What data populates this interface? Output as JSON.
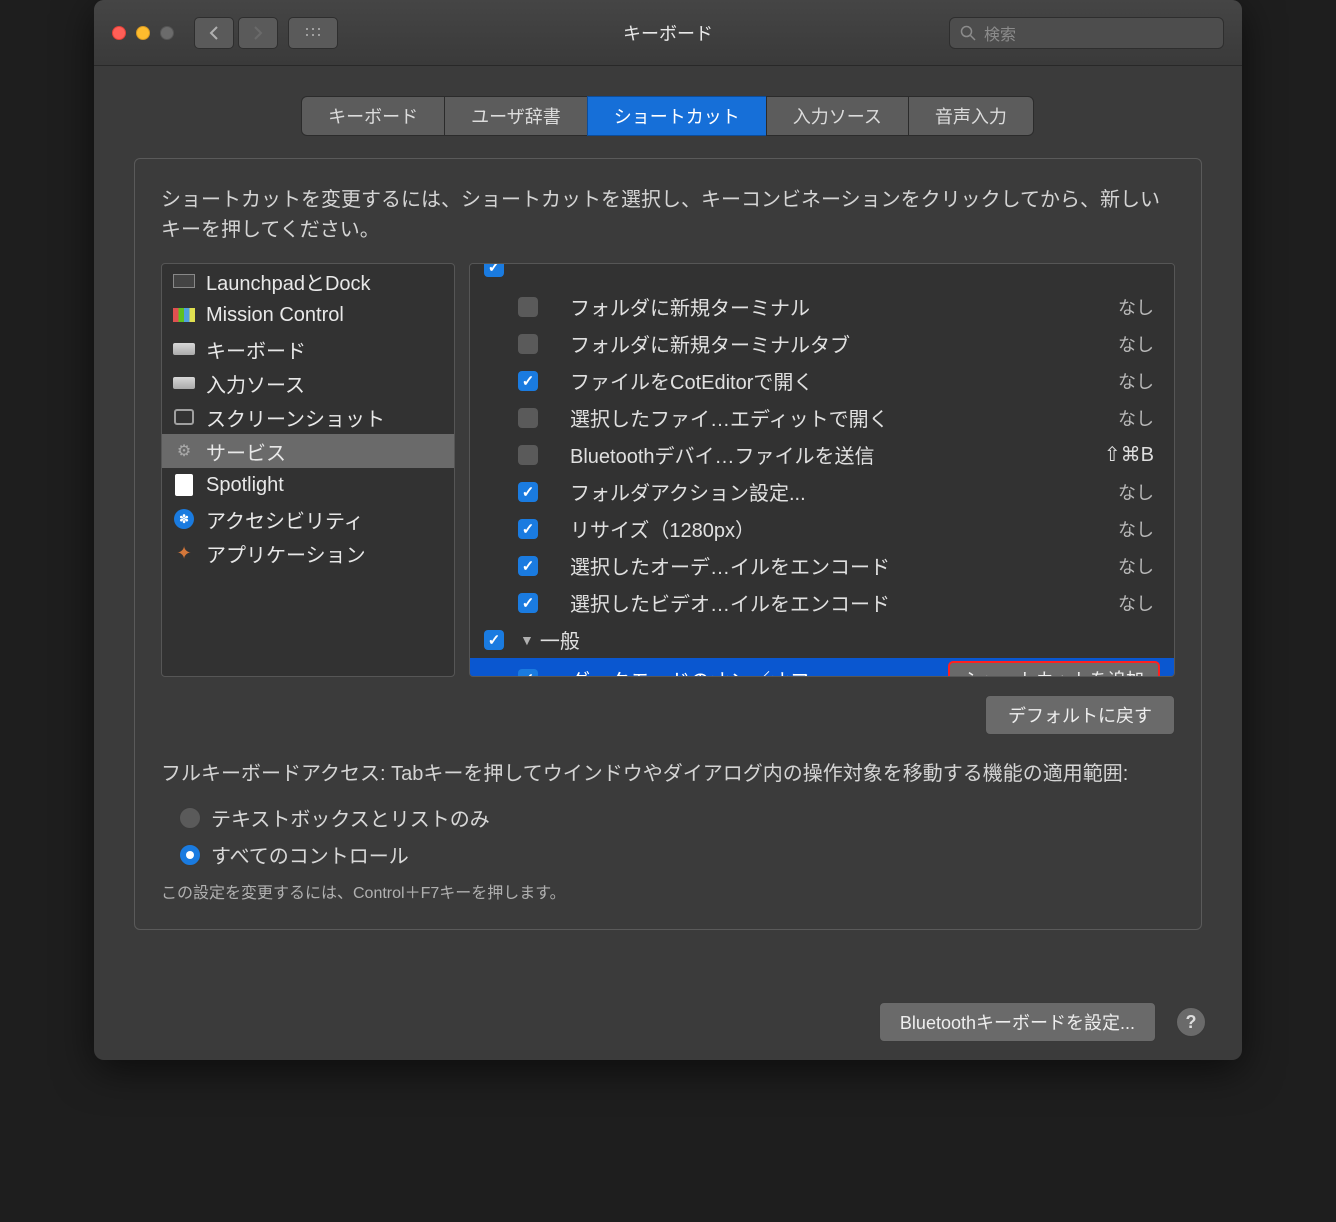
{
  "window": {
    "title": "キーボード",
    "search_placeholder": "検索"
  },
  "tabs": [
    {
      "label": "キーボード",
      "active": false
    },
    {
      "label": "ユーザ辞書",
      "active": false
    },
    {
      "label": "ショートカット",
      "active": true
    },
    {
      "label": "入力ソース",
      "active": false
    },
    {
      "label": "音声入力",
      "active": false
    }
  ],
  "instruction": "ショートカットを変更するには、ショートカットを選択し、キーコンビネーションをクリックしてから、新しいキーを押してください。",
  "categories": [
    {
      "label": "LaunchpadとDock",
      "icon": "launchpad"
    },
    {
      "label": "Mission Control",
      "icon": "mission"
    },
    {
      "label": "キーボード",
      "icon": "keyboard"
    },
    {
      "label": "入力ソース",
      "icon": "keyboard"
    },
    {
      "label": "スクリーンショット",
      "icon": "screenshot"
    },
    {
      "label": "サービス",
      "icon": "gear",
      "selected": true
    },
    {
      "label": "Spotlight",
      "icon": "spotlight"
    },
    {
      "label": "アクセシビリティ",
      "icon": "accessibility"
    },
    {
      "label": "アプリケーション",
      "icon": "app"
    }
  ],
  "shortcuts": [
    {
      "label": "フォルダに新規ターミナル",
      "checked": false,
      "value": "なし"
    },
    {
      "label": "フォルダに新規ターミナルタブ",
      "checked": false,
      "value": "なし"
    },
    {
      "label": "ファイルをCotEditorで開く",
      "checked": true,
      "value": "なし"
    },
    {
      "label": "選択したファイ…エディットで開く",
      "checked": false,
      "value": "なし"
    },
    {
      "label": "Bluetoothデバイ…ファイルを送信",
      "checked": false,
      "hotkey": "⇧⌘B"
    },
    {
      "label": "フォルダアクション設定...",
      "checked": true,
      "value": "なし"
    },
    {
      "label": "リサイズ（1280px）",
      "checked": true,
      "value": "なし"
    },
    {
      "label": "選択したオーデ…イルをエンコード",
      "checked": true,
      "value": "なし"
    },
    {
      "label": "選択したビデオ…イルをエンコード",
      "checked": true,
      "value": "なし"
    }
  ],
  "group": {
    "label": "一般",
    "checked": true,
    "items": [
      {
        "label": "ダークモードのオン／オフ",
        "checked": true,
        "selected": true,
        "action": "ショートカットを追加"
      }
    ]
  },
  "restore_label": "デフォルトに戻す",
  "keyboard_access": {
    "text": "フルキーボードアクセス: Tabキーを押してウインドウやダイアログ内の操作対象を移動する機能の適用範囲:",
    "options": [
      {
        "label": "テキストボックスとリストのみ",
        "checked": false
      },
      {
        "label": "すべてのコントロール",
        "checked": true
      }
    ],
    "note": "この設定を変更するには、Control＋F7キーを押します。"
  },
  "footer": {
    "setup": "Bluetoothキーボードを設定...",
    "help": "?"
  }
}
